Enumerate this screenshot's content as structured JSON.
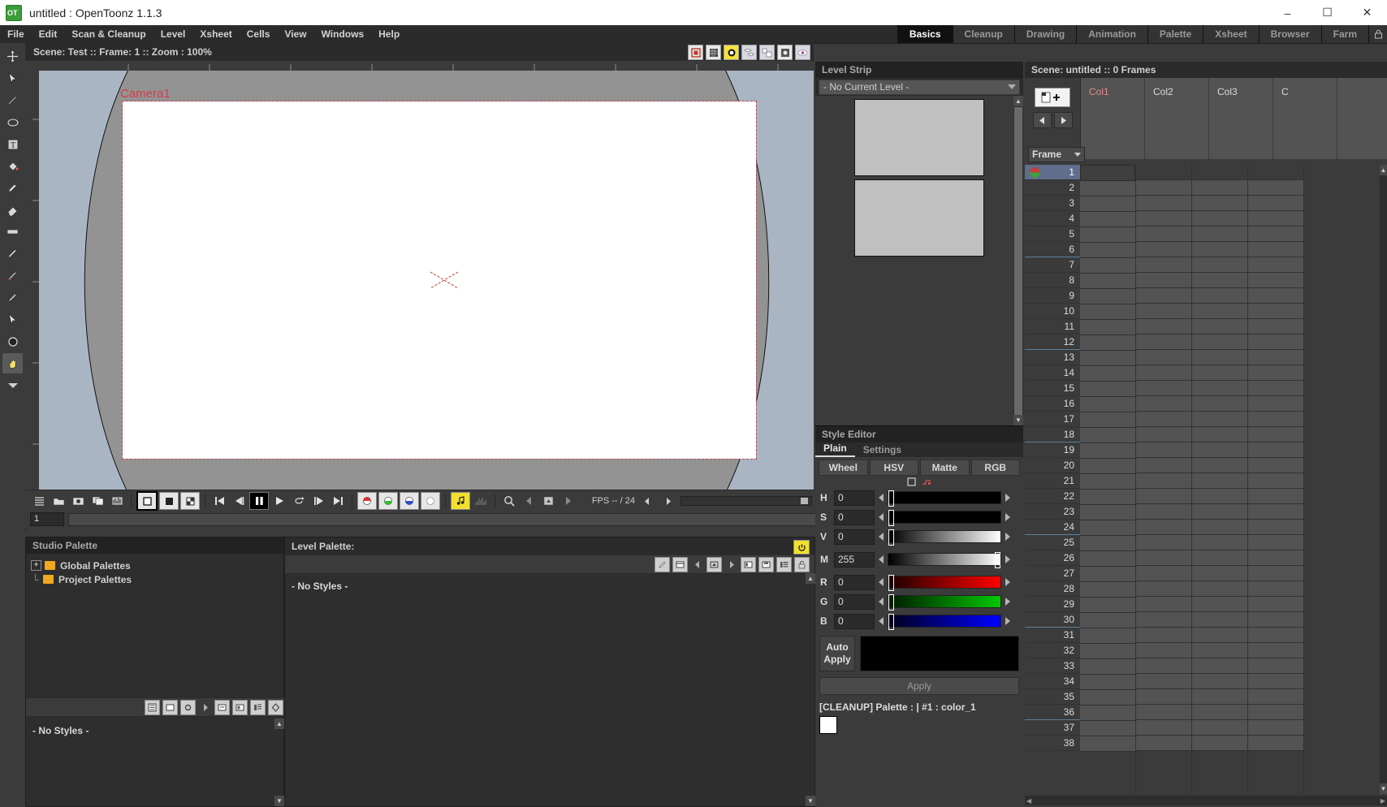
{
  "window": {
    "title": "untitled : OpenToonz 1.1.3",
    "logo_icon": "opentoonz-logo-icon",
    "minimize_label": "–",
    "maximize_label": "☐",
    "close_label": "✕"
  },
  "menubar": {
    "items": [
      {
        "label": "File"
      },
      {
        "label": "Edit"
      },
      {
        "label": "Scan & Cleanup"
      },
      {
        "label": "Level"
      },
      {
        "label": "Xsheet"
      },
      {
        "label": "Cells"
      },
      {
        "label": "View"
      },
      {
        "label": "Windows"
      },
      {
        "label": "Help"
      }
    ]
  },
  "rooms": {
    "items": [
      {
        "label": "Basics",
        "active": true
      },
      {
        "label": "Cleanup",
        "active": false
      },
      {
        "label": "Drawing",
        "active": false
      },
      {
        "label": "Animation",
        "active": false
      },
      {
        "label": "Palette",
        "active": false
      },
      {
        "label": "Xsheet",
        "active": false
      },
      {
        "label": "Browser",
        "active": false
      },
      {
        "label": "Farm",
        "active": false
      }
    ],
    "lock_icon": "lock-rooms-icon"
  },
  "toolbar": {
    "tools": [
      {
        "name": "animate-tool",
        "glyph": "✥"
      },
      {
        "name": "selection-tool",
        "glyph": "➤"
      },
      {
        "name": "brush-tool",
        "glyph": "✎"
      },
      {
        "name": "geometric-tool",
        "glyph": "◱"
      },
      {
        "name": "type-tool",
        "glyph": "◧"
      },
      {
        "name": "fill-tool",
        "glyph": "✇"
      },
      {
        "name": "paintbrush-tool",
        "glyph": "✐"
      },
      {
        "name": "eraser-tool",
        "glyph": "◰"
      },
      {
        "name": "tape-tool",
        "glyph": "⬚"
      },
      {
        "name": "style-picker-tool",
        "glyph": "✐"
      },
      {
        "name": "rgb-picker-tool",
        "glyph": "✏"
      },
      {
        "name": "control-point-editor-tool",
        "glyph": "✐"
      },
      {
        "name": "pinch-tool",
        "glyph": "↖"
      },
      {
        "name": "zoom-tool",
        "glyph": "⚬"
      },
      {
        "name": "hand-tool",
        "glyph": "✋",
        "selected": true
      },
      {
        "name": "more-tools-icon",
        "glyph": "▼"
      }
    ]
  },
  "viewer": {
    "title": "Scene: Test  ::  Frame: 1  ::  Zoom : 100%",
    "camera_label": "Camera1",
    "tools": [
      {
        "name": "safe-area-icon",
        "glyph": "▣",
        "style": "red"
      },
      {
        "name": "field-guide-icon",
        "glyph": "▒",
        "style": "plain"
      },
      {
        "name": "camera-view-icon",
        "glyph": "⬤",
        "style": "yellow"
      },
      {
        "name": "3d-view-icon",
        "glyph": "⧉",
        "style": "plain"
      },
      {
        "name": "camera-stand-view-icon",
        "glyph": "⧉",
        "style": "plain"
      },
      {
        "name": "preview-icon",
        "glyph": "✵",
        "style": "plain"
      },
      {
        "name": "sub-camera-preview-icon",
        "glyph": "◉",
        "style": "plain"
      }
    ],
    "playback": {
      "buttons": [
        {
          "name": "flip-console-menu-button",
          "glyph": "☰",
          "style": "flat"
        },
        {
          "name": "save-images-button",
          "glyph": "⎘",
          "style": "flat"
        },
        {
          "name": "snapshot-button",
          "glyph": "▣",
          "style": "flat"
        },
        {
          "name": "compare-button",
          "glyph": "◫",
          "style": "flat"
        },
        {
          "name": "histogram-button",
          "glyph": "▓",
          "style": "flat"
        },
        {
          "name": "white-bg-button",
          "glyph": "▣",
          "style": "boxsel"
        },
        {
          "name": "black-bg-button",
          "glyph": "■",
          "style": "box"
        },
        {
          "name": "checkered-bg-button",
          "glyph": "▨",
          "style": "box"
        },
        {
          "name": "first-frame-button",
          "glyph": "⏮",
          "style": "flat"
        },
        {
          "name": "previous-frame-button",
          "glyph": "◀❘",
          "style": "flat"
        },
        {
          "name": "pause-button",
          "glyph": "▐▌",
          "style": "act"
        },
        {
          "name": "play-button",
          "glyph": "▶",
          "style": "flat"
        },
        {
          "name": "loop-button",
          "glyph": "⟲",
          "style": "flat"
        },
        {
          "name": "next-frame-button",
          "glyph": "❘▶",
          "style": "flat"
        },
        {
          "name": "last-frame-button",
          "glyph": "⏭",
          "style": "flat"
        },
        {
          "name": "red-channel-button",
          "glyph": "◑",
          "style": "chan-r"
        },
        {
          "name": "green-channel-button",
          "glyph": "◑",
          "style": "chan-g"
        },
        {
          "name": "blue-channel-button",
          "glyph": "◑",
          "style": "chan-b"
        },
        {
          "name": "matte-channel-button",
          "glyph": "●",
          "style": "chan-m"
        },
        {
          "name": "sound-button",
          "glyph": "♫",
          "style": "yel"
        },
        {
          "name": "soundtrack-button",
          "glyph": "░",
          "style": "flat"
        },
        {
          "name": "zoom-reset-button",
          "glyph": "⌕",
          "style": "flat"
        },
        {
          "name": "locator-prev-button",
          "glyph": "◀",
          "style": "flat"
        },
        {
          "name": "locator-button",
          "glyph": "⌘",
          "style": "flat"
        },
        {
          "name": "locator-next-button",
          "glyph": "▶",
          "style": "flat"
        }
      ],
      "fps_label": "FPS -- / 24",
      "frame_field": "1"
    }
  },
  "studio_palette": {
    "title": "Studio Palette",
    "tree": [
      {
        "label": "Global Palettes",
        "expander": "+"
      },
      {
        "label": "Project Palettes",
        "expander": ""
      }
    ],
    "toolbar_icons": [
      {
        "name": "new-style-icon",
        "glyph": "▤"
      },
      {
        "name": "new-page-icon",
        "glyph": "◧"
      },
      {
        "name": "gear-icon",
        "glyph": "⚙"
      },
      {
        "name": "next-icon",
        "glyph": "▶"
      },
      {
        "name": "name-editor-icon",
        "glyph": "▥"
      },
      {
        "name": "new-palette-icon",
        "glyph": "▦"
      },
      {
        "name": "switch-view-icon",
        "glyph": "▤"
      },
      {
        "name": "keyframe-icon",
        "glyph": "⬡"
      }
    ],
    "no_styles": "- No Styles -"
  },
  "level_palette": {
    "title": "Level Palette:",
    "power_icon": "toggle-power-icon",
    "no_styles": "- No Styles -",
    "toolbar_icons": [
      {
        "name": "new-style-icon",
        "glyph": "✎"
      },
      {
        "name": "new-page-icon",
        "glyph": "▤"
      },
      {
        "name": "prev-key-icon",
        "glyph": "◀"
      },
      {
        "name": "set-key-icon",
        "glyph": "⌘"
      },
      {
        "name": "next-key-icon",
        "glyph": "▶"
      },
      {
        "name": "new-palette-icon",
        "glyph": "▣"
      },
      {
        "name": "save-palette-icon",
        "glyph": "▦"
      },
      {
        "name": "name-display-icon",
        "glyph": "▥"
      },
      {
        "name": "lock-icon",
        "glyph": "⚿"
      }
    ]
  },
  "level_strip": {
    "title": "Level Strip",
    "level_selector": "- No Current Level -",
    "thumbnails": 2
  },
  "style_editor": {
    "title": "Style Editor",
    "tabs": [
      {
        "label": "Plain",
        "active": true
      },
      {
        "label": "Settings",
        "active": false
      }
    ],
    "modes": [
      {
        "label": "Wheel",
        "active": false
      },
      {
        "label": "HSV",
        "active": false
      },
      {
        "label": "Matte",
        "active": false
      },
      {
        "label": "RGB",
        "active": false
      }
    ],
    "subbar_icons": [
      {
        "name": "square-swatch-icon",
        "glyph": "□"
      },
      {
        "name": "pick-screen-icon",
        "glyph": "⚑"
      }
    ],
    "sliders": [
      {
        "label": "H",
        "value": "0",
        "gradient": "linear-gradient(to right,#000,#000)",
        "knob_pct": 0
      },
      {
        "label": "S",
        "value": "0",
        "gradient": "linear-gradient(to right,#000,#000)",
        "knob_pct": 0
      },
      {
        "label": "V",
        "value": "0",
        "gradient": "linear-gradient(to right,#000,#ffffff)",
        "knob_pct": 0
      },
      {
        "label": "M",
        "value": "255",
        "gradient": "linear-gradient(to right,#000,#ffffff)",
        "knob_pct": 100
      },
      {
        "label": "R",
        "value": "0",
        "gradient": "linear-gradient(to right,#1a0000,#ff0000)",
        "knob_pct": 0
      },
      {
        "label": "G",
        "value": "0",
        "gradient": "linear-gradient(to right,#001a00,#00c800)",
        "knob_pct": 0
      },
      {
        "label": "B",
        "value": "0",
        "gradient": "linear-gradient(to right,#00001a,#0000ff)",
        "knob_pct": 0
      }
    ],
    "auto_apply_label": "Auto\nApply",
    "auto_apply_line1": "Auto",
    "auto_apply_line2": "Apply",
    "apply_label": "Apply",
    "status": "[CLEANUP]  Palette : | #1 : color_1",
    "chip_color": "#000000",
    "swatch_color": "#ffffff"
  },
  "xsheet": {
    "title": "Scene: untitled  ::  0 Frames",
    "new_level_button": "+",
    "nav_prev": "◀",
    "nav_next": "▶",
    "frame_header": "Frame",
    "columns": [
      {
        "label": "Col1",
        "accent": "#e08b8b"
      },
      {
        "label": "Col2",
        "accent": "#dcdcdc"
      },
      {
        "label": "Col3",
        "accent": "#dcdcdc"
      },
      {
        "label": "C",
        "accent": "#dcdcdc"
      }
    ],
    "frames": [
      1,
      2,
      3,
      4,
      5,
      6,
      7,
      8,
      9,
      10,
      11,
      12,
      13,
      14,
      15,
      16,
      17,
      18,
      19,
      20,
      21,
      22,
      23,
      24,
      25,
      26,
      27,
      28,
      29,
      30,
      31,
      32,
      33,
      34,
      35,
      36,
      37,
      38
    ],
    "selected_frame": 1,
    "marker_interval": 6
  },
  "colors": {
    "accent_yellow": "#f2e12c",
    "panel_bg": "#3b3b3b",
    "panel_dark": "#2b2b2b",
    "selection_blue": "#5e6e8c",
    "camera_red": "#d0404a"
  }
}
